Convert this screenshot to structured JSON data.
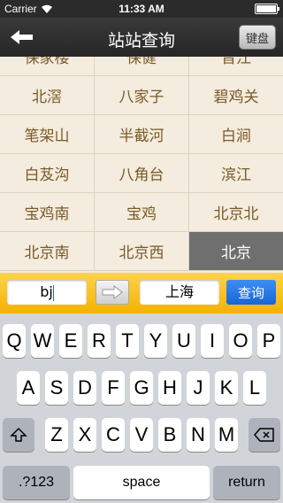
{
  "status": {
    "carrier": "Carrier",
    "time": "11:33 AM"
  },
  "navbar": {
    "title": "站站查询",
    "keyboard_label": "键盘"
  },
  "stations": [
    [
      "保家楼",
      "保健",
      "晋江"
    ],
    [
      "北滘",
      "八家子",
      "碧鸡关"
    ],
    [
      "笔架山",
      "半截河",
      "白涧"
    ],
    [
      "白芨沟",
      "八角台",
      "滨江"
    ],
    [
      "宝鸡南",
      "宝鸡",
      "北京北"
    ],
    [
      "北京南",
      "北京西",
      "北京"
    ]
  ],
  "selected_station": "北京",
  "search": {
    "from_value": "bj",
    "to_value": "上海",
    "query_label": "查询"
  },
  "keyboard": {
    "row1": [
      "Q",
      "W",
      "E",
      "R",
      "T",
      "Y",
      "U",
      "I",
      "O",
      "P"
    ],
    "row2": [
      "A",
      "S",
      "D",
      "F",
      "G",
      "H",
      "J",
      "K",
      "L"
    ],
    "row3": [
      "Z",
      "X",
      "C",
      "V",
      "B",
      "N",
      "M"
    ],
    "numbers_label": ".?123",
    "space_label": "space",
    "return_label": "return"
  }
}
